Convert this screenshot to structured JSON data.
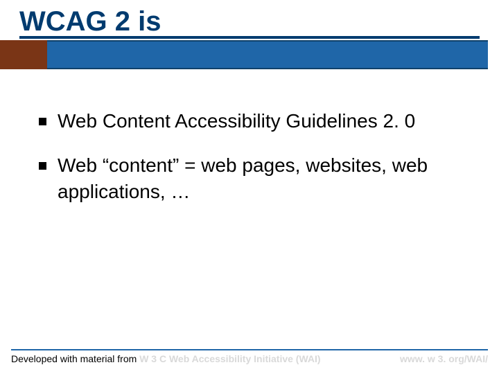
{
  "title": "WCAG 2 is",
  "bullets": [
    "Web Content Accessibility Guidelines 2. 0",
    "Web “content” = web pages, websites, web applications, …"
  ],
  "footer": {
    "prefix": "Developed with material from ",
    "org": "W 3 C Web Accessibility Initiative (WAI)",
    "url": "www. w 3. org/WAI/"
  }
}
